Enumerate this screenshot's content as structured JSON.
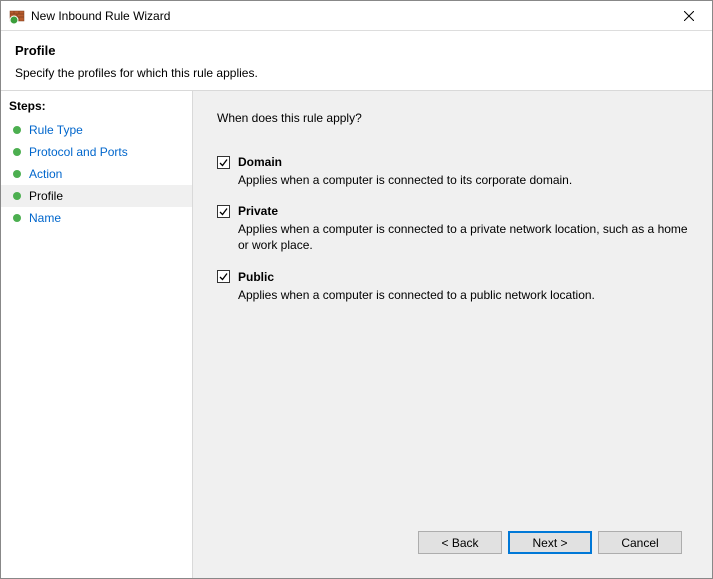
{
  "window": {
    "title": "New Inbound Rule Wizard"
  },
  "header": {
    "title": "Profile",
    "subtitle": "Specify the profiles for which this rule applies."
  },
  "sidebar": {
    "steps_label": "Steps:",
    "items": [
      {
        "label": "Rule Type"
      },
      {
        "label": "Protocol and Ports"
      },
      {
        "label": "Action"
      },
      {
        "label": "Profile"
      },
      {
        "label": "Name"
      }
    ],
    "current_index": 3
  },
  "content": {
    "question": "When does this rule apply?",
    "options": [
      {
        "label": "Domain",
        "description": "Applies when a computer is connected to its corporate domain.",
        "checked": true
      },
      {
        "label": "Private",
        "description": "Applies when a computer is connected to a private network location, such as a home or work place.",
        "checked": true
      },
      {
        "label": "Public",
        "description": "Applies when a computer is connected to a public network location.",
        "checked": true
      }
    ]
  },
  "footer": {
    "back_label": "< Back",
    "next_label": "Next >",
    "cancel_label": "Cancel"
  }
}
